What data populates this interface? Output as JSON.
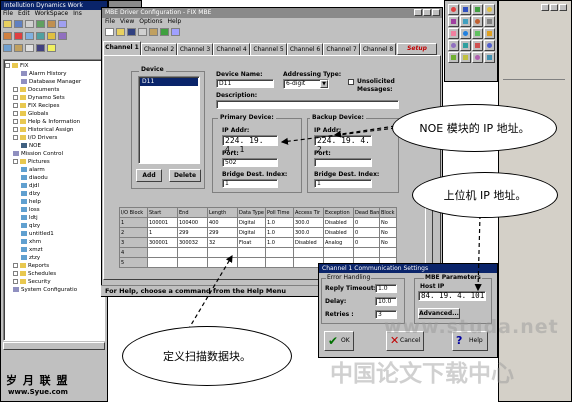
{
  "ide": {
    "title": "Intellution Dynamics Work",
    "menu": [
      "File",
      "Edit",
      "WorkSpace",
      "Ins"
    ],
    "tree": [
      {
        "label": "FIX",
        "indent": 0,
        "type": "root"
      },
      {
        "label": "Alarm History",
        "indent": 2,
        "type": "doc"
      },
      {
        "label": "Database Manager",
        "indent": 2,
        "type": "doc"
      },
      {
        "label": "Documents",
        "indent": 1,
        "type": "folder"
      },
      {
        "label": "Dynamo Sets",
        "indent": 1,
        "type": "folder"
      },
      {
        "label": "FIX Recipes",
        "indent": 1,
        "type": "folder"
      },
      {
        "label": "Globals",
        "indent": 1,
        "type": "folder"
      },
      {
        "label": "Help & Information",
        "indent": 1,
        "type": "folder"
      },
      {
        "label": "Historical Assign",
        "indent": 1,
        "type": "folder"
      },
      {
        "label": "I/O Drivers",
        "indent": 1,
        "type": "folder"
      },
      {
        "label": "NOE",
        "indent": 2,
        "type": "driver"
      },
      {
        "label": "Mission Control",
        "indent": 1,
        "type": "doc"
      },
      {
        "label": "Pictures",
        "indent": 1,
        "type": "folder"
      },
      {
        "label": "alarm",
        "indent": 2,
        "type": "pic"
      },
      {
        "label": "diaodu",
        "indent": 2,
        "type": "pic"
      },
      {
        "label": "djdl",
        "indent": 2,
        "type": "pic"
      },
      {
        "label": "dlzy",
        "indent": 2,
        "type": "pic"
      },
      {
        "label": "help",
        "indent": 2,
        "type": "pic"
      },
      {
        "label": "loss",
        "indent": 2,
        "type": "pic"
      },
      {
        "label": "ldtj",
        "indent": 2,
        "type": "pic"
      },
      {
        "label": "qlzy",
        "indent": 2,
        "type": "pic"
      },
      {
        "label": "untitled1",
        "indent": 2,
        "type": "pic"
      },
      {
        "label": "xhm",
        "indent": 2,
        "type": "pic"
      },
      {
        "label": "xmzt",
        "indent": 2,
        "type": "pic"
      },
      {
        "label": "ztzy",
        "indent": 2,
        "type": "pic"
      },
      {
        "label": "Reports",
        "indent": 1,
        "type": "folder"
      },
      {
        "label": "Schedules",
        "indent": 1,
        "type": "folder"
      },
      {
        "label": "Security",
        "indent": 1,
        "type": "folder"
      },
      {
        "label": "System Configuratio",
        "indent": 1,
        "type": "doc"
      }
    ]
  },
  "mbe": {
    "title": "MBE Driver Configuration - FIX MBE",
    "menu": [
      "File",
      "View",
      "Options",
      "Help"
    ],
    "tabs": [
      "Channel 1",
      "Channel 2",
      "Channel 3",
      "Channel 4",
      "Channel 5",
      "Channel 6",
      "Channel 7",
      "Channel 8"
    ],
    "active_tab": "Channel 1",
    "setup_label": "Setup",
    "device_group": "Device",
    "device_list": [
      "D11"
    ],
    "add_label": "Add",
    "delete_label": "Delete",
    "device_name_label": "Device Name:",
    "device_name": "D11",
    "addressing_label": "Addressing Type:",
    "addressing_value": "6-digit",
    "unsolicited_label": "Unsolicited",
    "messages_label": "Messages:",
    "description_label": "Description:",
    "description": "",
    "primary_label": "Primary Device:",
    "primary_ip_label": "IP Addr:",
    "primary_ip": "224. 19. 4. 1",
    "primary_port_label": "Port:",
    "primary_port": "502",
    "primary_bridge_label": "Bridge Dest. Index:",
    "primary_bridge": "1",
    "backup_label": "Backup Device:",
    "backup_ip_label": "IP Addr:",
    "backup_ip": "224. 19. 4. 2",
    "backup_port_label": "Port:",
    "backup_port": "",
    "backup_bridge_label": "Bridge Dest. Index:",
    "backup_bridge": "1",
    "grid_headers": [
      "I/O Block",
      "Start",
      "End",
      "Length",
      "Data Type",
      "Poll Time",
      "Access Tir",
      "Exception",
      "Dead Band",
      "Block"
    ],
    "grid_rows": [
      [
        "1",
        "100001",
        "100400",
        "400",
        "Digital",
        "1.0",
        "300.0",
        "Disabled",
        "0",
        "No"
      ],
      [
        "2",
        "1",
        "299",
        "299",
        "Digital",
        "1.0",
        "300.0",
        "Disabled",
        "0",
        "No"
      ],
      [
        "3",
        "300001",
        "300032",
        "32",
        "Float",
        "1.0",
        "Disabled",
        "Analog",
        "0",
        "No"
      ],
      [
        "4",
        "",
        "",
        "",
        "",
        "",
        "",
        "",
        "",
        ""
      ],
      [
        "5",
        "",
        "",
        "",
        "",
        "",
        "",
        "",
        "",
        ""
      ]
    ],
    "status": "For Help, choose a command from the Help Menu"
  },
  "comm": {
    "title": "Channel 1 Communication Settings",
    "error_group": "Error Handling",
    "reply_label": "Reply Timeout:",
    "reply_value": "1.0",
    "delay_label": "Delay:",
    "delay_value": "10.0",
    "retries_label": "Retries :",
    "retries_value": "3",
    "params_group": "MBE Parameters",
    "host_ip_label": "Host IP",
    "host_ip": "84. 19. 4. 101",
    "advanced_label": "Advanced...",
    "ok_label": "OK",
    "cancel_label": "Cancel",
    "help_label": "Help"
  },
  "annotations": {
    "noe_ip": "NOE 模块的 IP 地址。",
    "host_ip": "上位机 IP 地址。",
    "scan_block": "定义扫描数据块。"
  },
  "watermarks": {
    "yuesheng": "岁 月 联 盟",
    "yuesheng_url": "www.Syue.com",
    "studa": "www.studa.net",
    "studa_cn": "中国论文下载中心"
  },
  "colors": {
    "title_bar": "#0a246a",
    "window_face": "#c0c0c0",
    "setup_text": "#c00000"
  }
}
